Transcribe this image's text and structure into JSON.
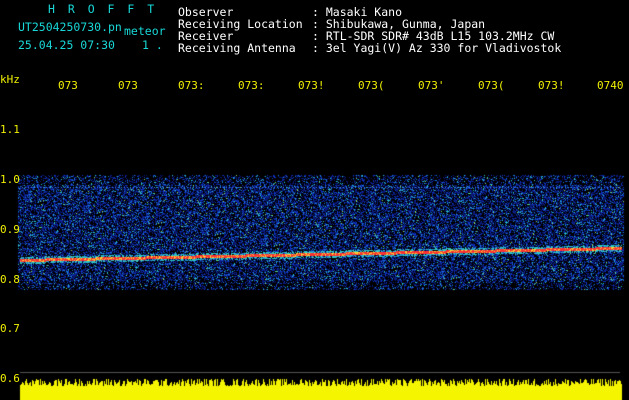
{
  "header": {
    "logo": "H R O F F T",
    "filename": "UT2504250730.pn",
    "meteor_label": "meteor",
    "datetime": "25.04.25 07:30",
    "counter": "1 .",
    "observer_label": "Observer",
    "observer_value": ": Masaki Kano",
    "location_label": "Receiving Location",
    "location_value": ": Shibukawa, Gunma, Japan",
    "receiver_label": "Receiver",
    "receiver_value": ": RTL-SDR SDR# 43dB L15 103.2MHz CW",
    "antenna_label": "Receiving Antenna",
    "antenna_value": ": 3el Yagi(V) Az 330 for Vladivostok"
  },
  "axis": {
    "unit": "kHz",
    "time_ticks": [
      "073",
      "073",
      "073:",
      "073:",
      "073!",
      "073(",
      "073'",
      "073(",
      "073!",
      "0740"
    ],
    "freq_ticks": [
      "1.1",
      "1.0",
      "0.9",
      "0.8",
      "0.7",
      "0.6"
    ]
  },
  "colors": {
    "background": "#000000",
    "header_cyan": "#19d7d7",
    "header_white": "#ffffff",
    "axis_yellow": "#f0f000",
    "carrier_red": "#ff3030",
    "noise_floor_yellow": "#f5f500"
  }
}
